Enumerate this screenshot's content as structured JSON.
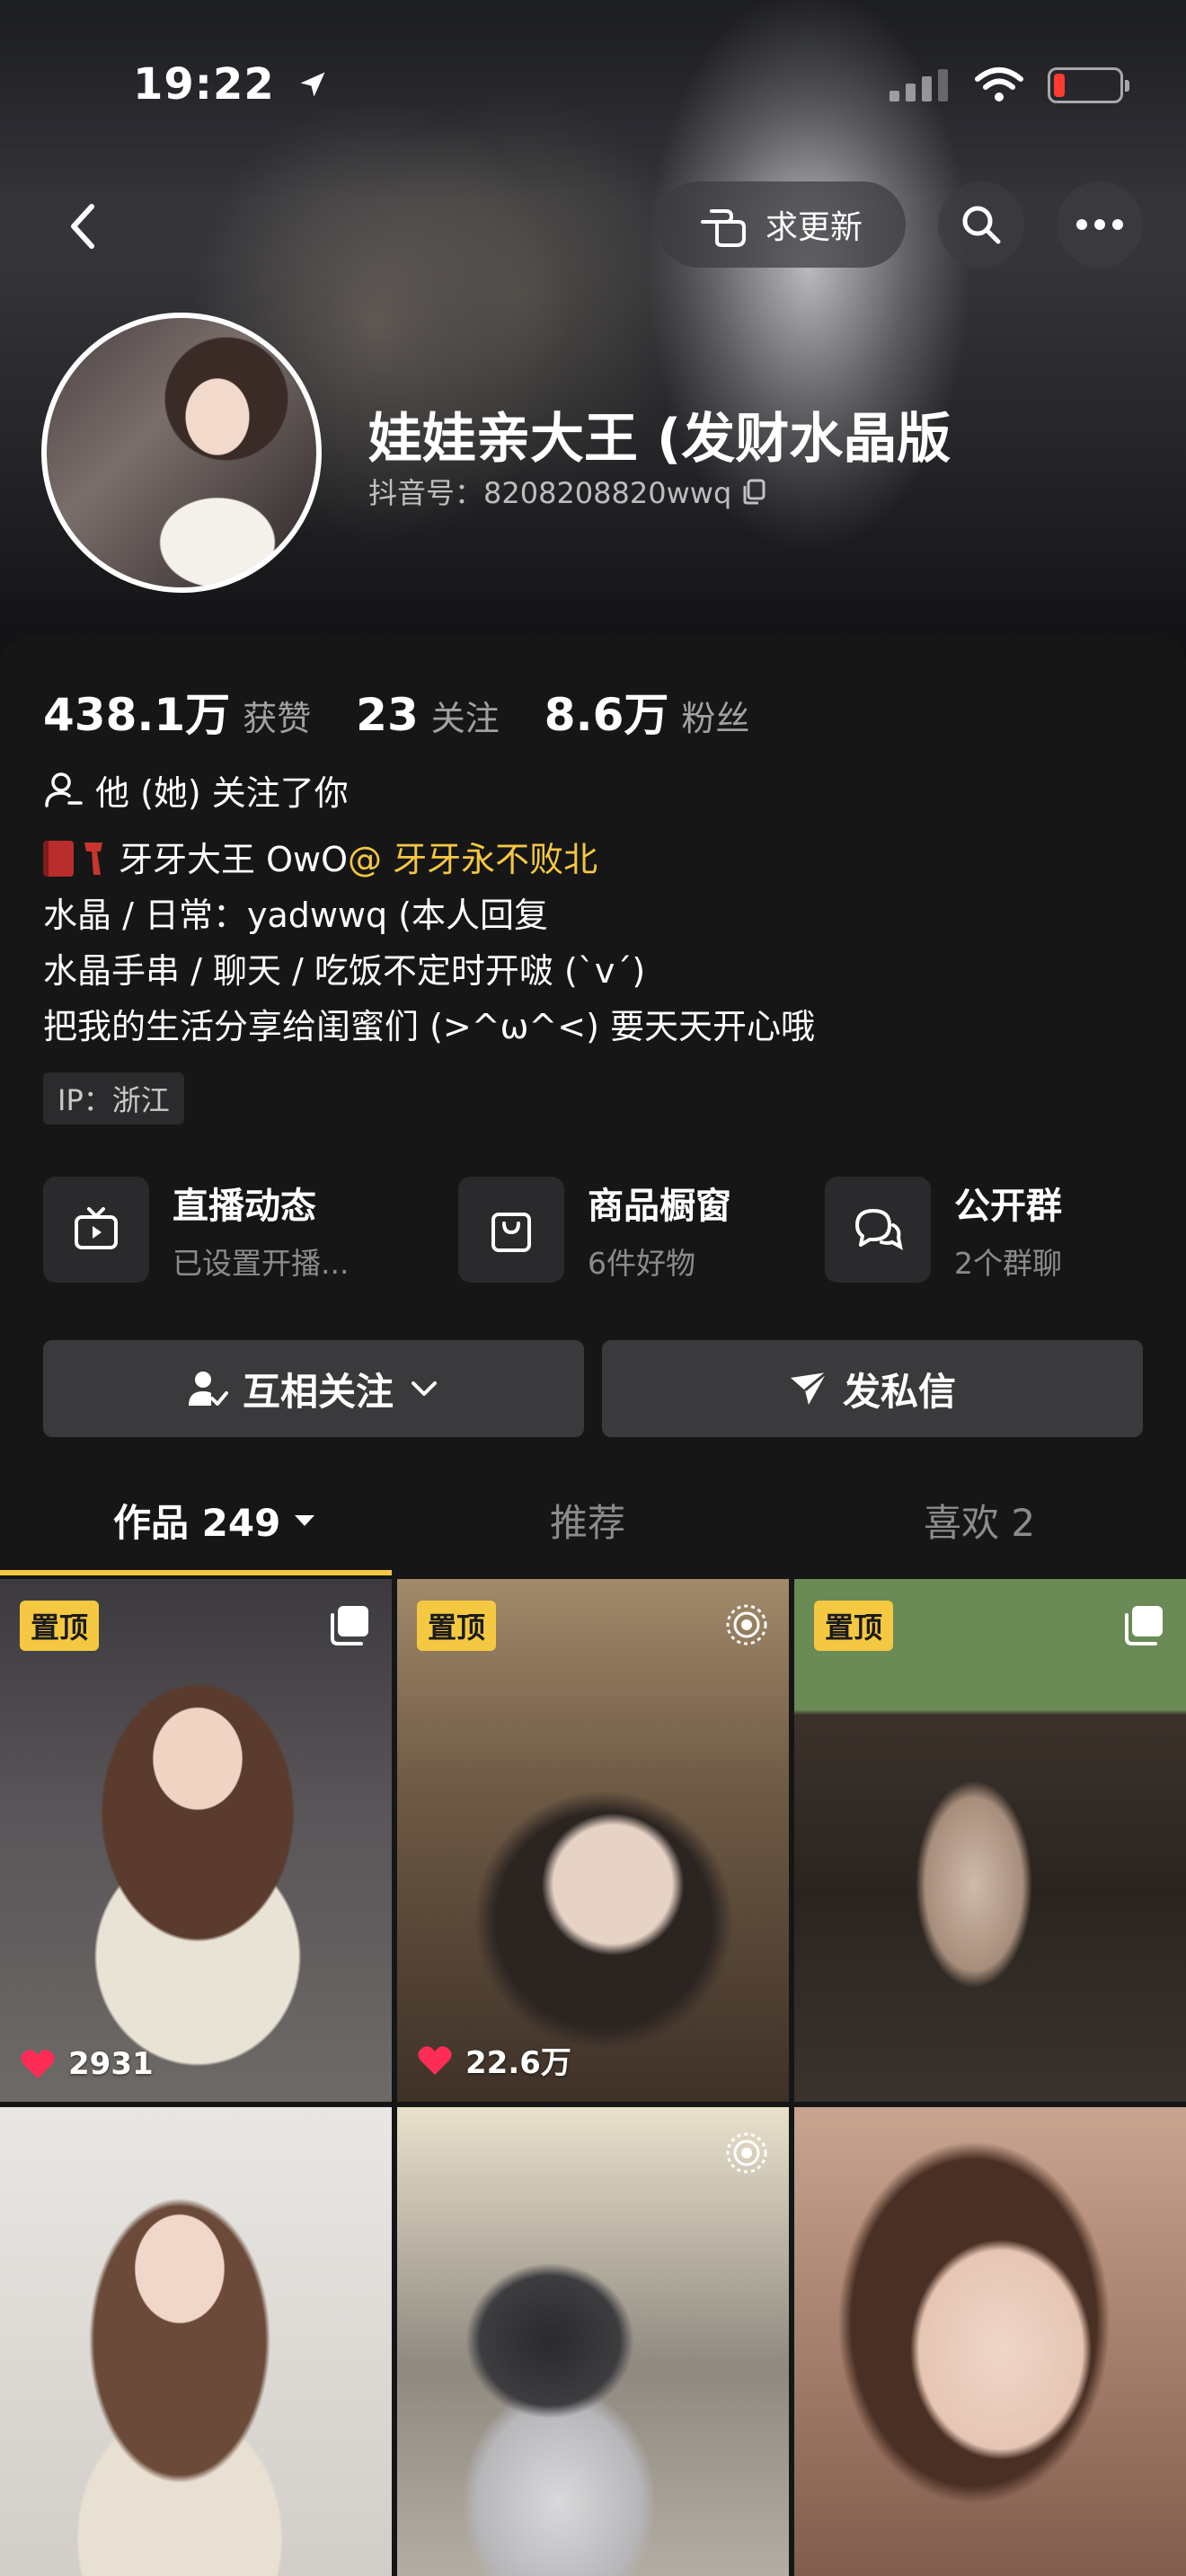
{
  "status_bar": {
    "time": "19:22"
  },
  "header": {
    "request_update_label": "求更新",
    "profile_name": "娃娃亲大王 (发财水晶版",
    "douyin_id": "抖音号：8208208820wwq"
  },
  "stats": [
    {
      "value": "438.1万",
      "label": "获赞"
    },
    {
      "value": "23",
      "label": "关注"
    },
    {
      "value": "8.6万",
      "label": "粉丝"
    }
  ],
  "follow_status": "他 (她) 关注了你",
  "bio": {
    "line1_text": "牙牙大王 OwO",
    "line1_mention": "@ 牙牙永不败北",
    "line2": "水晶 / 日常：yadwwq (本人回复",
    "line3": "水晶手串 / 聊天 / 吃饭不定时开啵 (`v´)",
    "line4": "把我的生活分享给闺蜜们 (>^ω^<) 要天天开心哦"
  },
  "ip_location": "IP：浙江",
  "features": [
    {
      "title": "直播动态",
      "subtitle": "已设置开播...",
      "icon": "tv-icon"
    },
    {
      "title": "商品橱窗",
      "subtitle": "6件好物",
      "icon": "bag-icon"
    },
    {
      "title": "公开群",
      "subtitle": "2个群聊",
      "icon": "chat-icon"
    }
  ],
  "actions": {
    "mutual_follow_label": "互相关注",
    "message_label": "发私信"
  },
  "tabs": [
    {
      "label": "作品 249",
      "active": true
    },
    {
      "label": "推荐",
      "active": false
    },
    {
      "label": "喜欢 2",
      "active": false
    }
  ],
  "grid": [
    {
      "pinned": true,
      "pin_label": "置顶",
      "likes": "2931",
      "corner_icon": "gallery-icon"
    },
    {
      "pinned": true,
      "pin_label": "置顶",
      "likes": "22.6万",
      "corner_icon": "live-photo-icon"
    },
    {
      "pinned": true,
      "pin_label": "置顶",
      "likes": "",
      "corner_icon": "gallery-icon"
    },
    {
      "pinned": false,
      "pin_label": "",
      "likes": "",
      "corner_icon": ""
    },
    {
      "pinned": false,
      "pin_label": "",
      "likes": "",
      "corner_icon": "live-photo-icon"
    },
    {
      "pinned": false,
      "pin_label": "",
      "likes": "",
      "corner_icon": ""
    }
  ],
  "colors": {
    "background": "#161616",
    "accent_yellow": "#f5c842",
    "button_gray": "#3a3a3c",
    "like_red": "#ff2c55"
  }
}
